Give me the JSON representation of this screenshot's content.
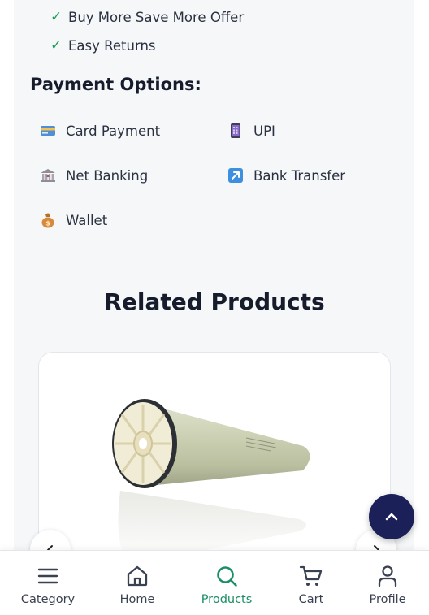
{
  "benefits": [
    {
      "icon": "check-icon",
      "text": "Buy More Save More Offer"
    },
    {
      "icon": "check-icon",
      "text": "Easy Returns"
    }
  ],
  "check_glyph": "✓",
  "payment": {
    "title": "Payment Options:",
    "options": [
      {
        "icon": "credit-card-icon",
        "label": "Card Payment"
      },
      {
        "icon": "mobile-phone-icon",
        "label": "UPI"
      },
      {
        "icon": "bank-icon",
        "label": "Net Banking"
      },
      {
        "icon": "arrow-up-right-icon",
        "label": "Bank Transfer"
      },
      {
        "icon": "money-bag-icon",
        "label": "Wallet"
      }
    ]
  },
  "related": {
    "title": "Related Products"
  },
  "bottom_nav": {
    "items": [
      {
        "icon": "menu-icon",
        "label": "Category",
        "active": false
      },
      {
        "icon": "home-icon",
        "label": "Home",
        "active": false
      },
      {
        "icon": "search-icon",
        "label": "Products",
        "active": true
      },
      {
        "icon": "cart-icon",
        "label": "Cart",
        "active": false
      },
      {
        "icon": "user-icon",
        "label": "Profile",
        "active": false
      }
    ]
  },
  "colors": {
    "accent": "#1a8f63",
    "check": "#1f9d55",
    "scroll_top_bg": "#1b2058",
    "panel_bg": "#f6f7f9"
  }
}
